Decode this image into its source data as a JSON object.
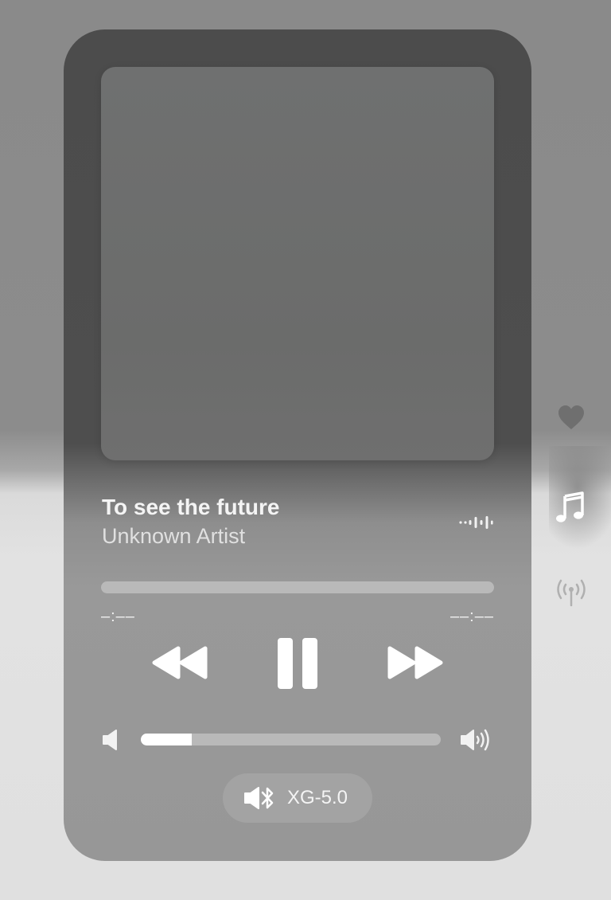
{
  "now_playing": {
    "title": "To see the future",
    "artist": "Unknown Artist"
  },
  "playback": {
    "elapsed": "–:––",
    "remaining": "––:––",
    "progress_fraction": 0
  },
  "volume": {
    "level_fraction": 0.17
  },
  "output": {
    "device": "XG-5.0",
    "icon": "speaker-bluetooth-icon"
  },
  "side_icons": [
    "heart-icon",
    "music-note-icon",
    "broadcast-icon"
  ],
  "colors": {
    "accent": "#ffffff",
    "card": "#4e4e4e"
  }
}
